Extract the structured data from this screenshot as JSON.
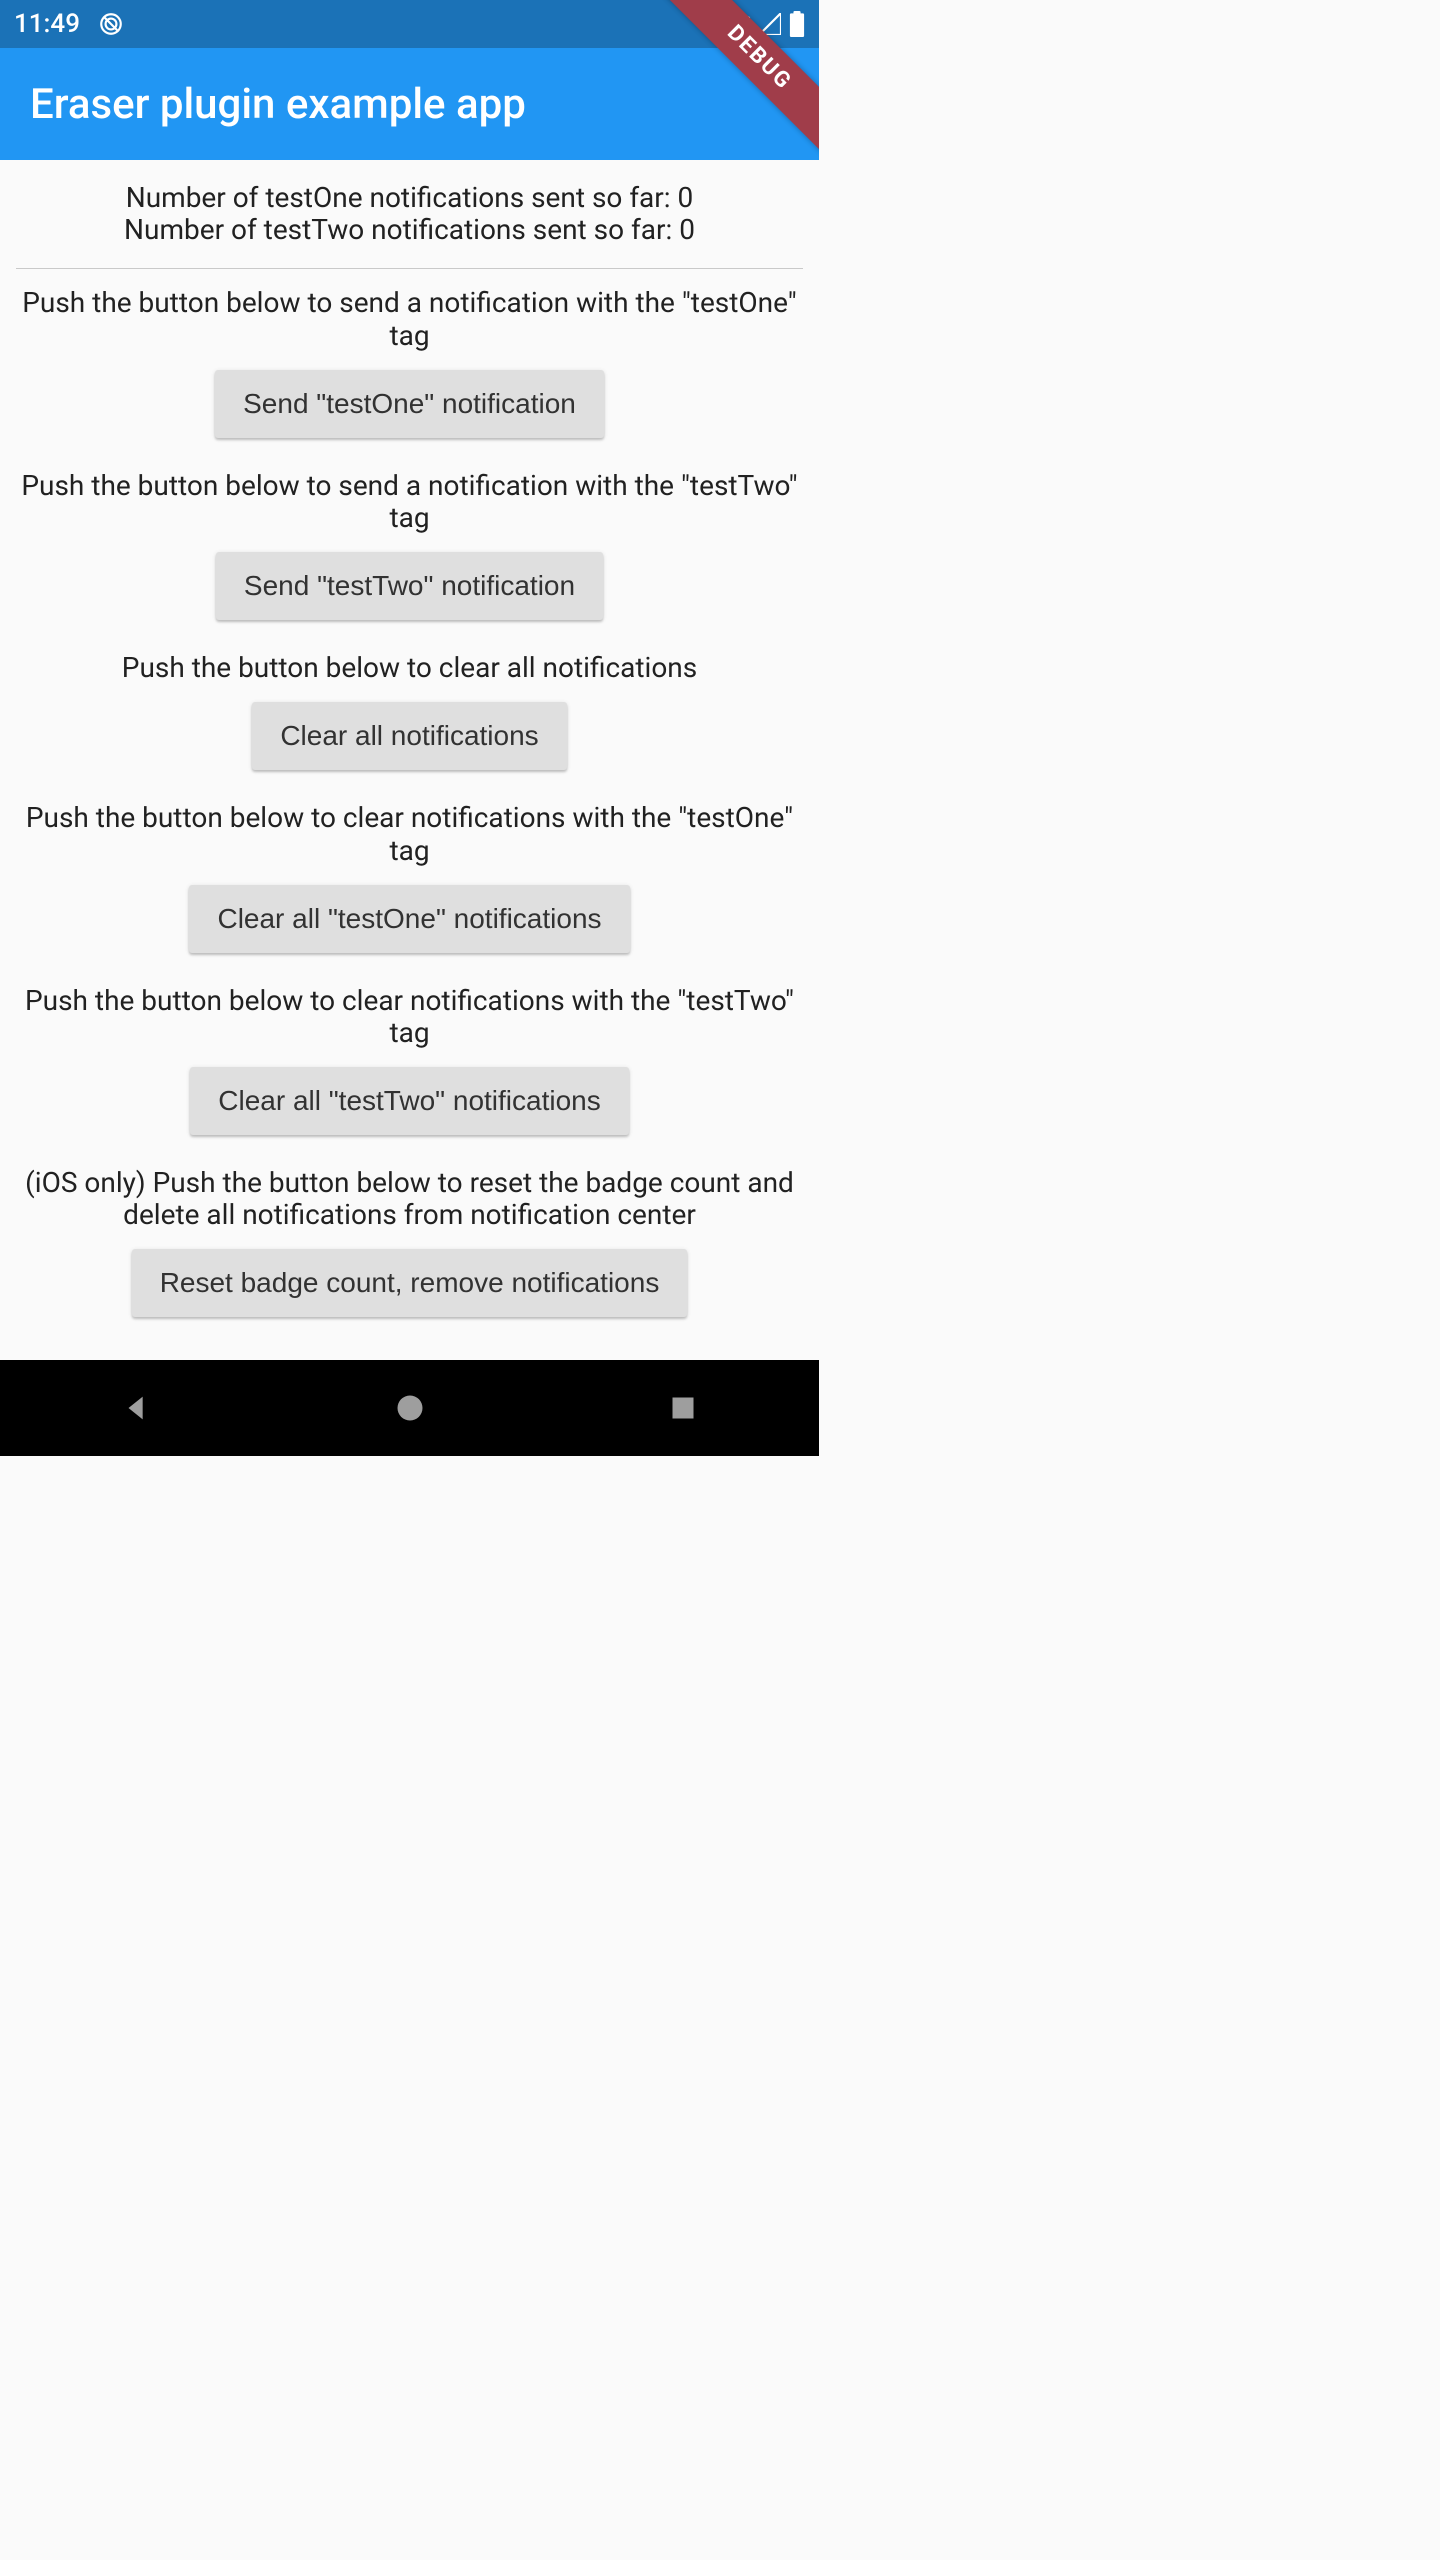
{
  "statusbar": {
    "time": "11:49",
    "dnd_icon": "do-not-disturb-icon",
    "wifi_icon": "wifi-icon",
    "cell_icon": "cell-signal-icon",
    "battery_icon": "battery-icon"
  },
  "debug_banner": "DEBUG",
  "appbar": {
    "title": "Eraser plugin example app"
  },
  "counters": {
    "testOne_label": "Number of testOne notifications sent so far: ",
    "testOne_value": "0",
    "testTwo_label": "Number of testTwo notifications sent so far: ",
    "testTwo_value": "0"
  },
  "sections": {
    "sendOne": {
      "desc": "Push the button below to send a notification with the \"testOne\" tag",
      "button": "Send \"testOne\" notification"
    },
    "sendTwo": {
      "desc": "Push the button below to send a notification with the \"testTwo\" tag",
      "button": "Send \"testTwo\" notification"
    },
    "clearAll": {
      "desc": "Push the button below to clear all notifications",
      "button": "Clear all notifications"
    },
    "clearOne": {
      "desc": "Push the button below to clear notifications with the \"testOne\" tag",
      "button": "Clear all \"testOne\" notifications"
    },
    "clearTwo": {
      "desc": "Push the button below to clear notifications with the \"testTwo\" tag",
      "button": "Clear all \"testTwo\" notifications"
    },
    "resetBadge": {
      "desc": "(iOS only) Push the button below to reset the badge count and delete all notifications from notification center",
      "button": "Reset badge count, remove notifications"
    }
  },
  "navbar": {
    "back": "back",
    "home": "home",
    "recents": "recents"
  }
}
